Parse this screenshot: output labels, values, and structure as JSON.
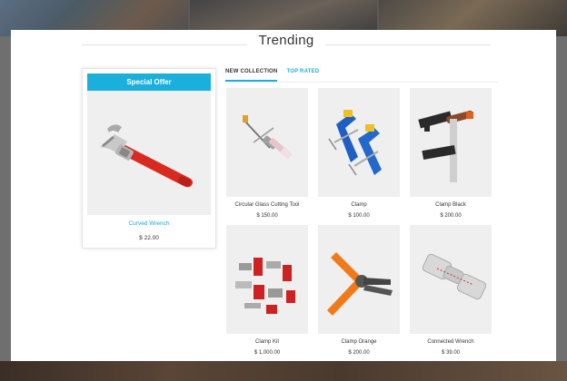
{
  "section": {
    "title": "Trending"
  },
  "special_offer": {
    "header": "Special Offer",
    "product_name": "Curved Wrench",
    "price": "$ 22.00"
  },
  "tabs": [
    {
      "label": "NEW COLLECTION",
      "active": true
    },
    {
      "label": "TOP RATED",
      "active": false
    }
  ],
  "products": [
    {
      "name": "Circular Glass Cutting Tool",
      "price": "$ 150.00"
    },
    {
      "name": "Clamp",
      "price": "$ 100.00"
    },
    {
      "name": "Clamp Black",
      "price": "$ 200.00"
    },
    {
      "name": "Clamp Kit",
      "price": "$ 1,000.00"
    },
    {
      "name": "Clamp Orange",
      "price": "$ 200.00"
    },
    {
      "name": "Connected Wrench",
      "price": "$ 39.00"
    }
  ],
  "colors": {
    "accent": "#1bb0dc",
    "text": "#333333",
    "image_bg": "#efefef"
  },
  "icons": [
    "pipe-wrench-image",
    "glass-cutter-image",
    "c-clamp-image",
    "bar-clamp-image",
    "clamp-kit-image",
    "spring-clamp-image",
    "socket-wrench-image"
  ]
}
